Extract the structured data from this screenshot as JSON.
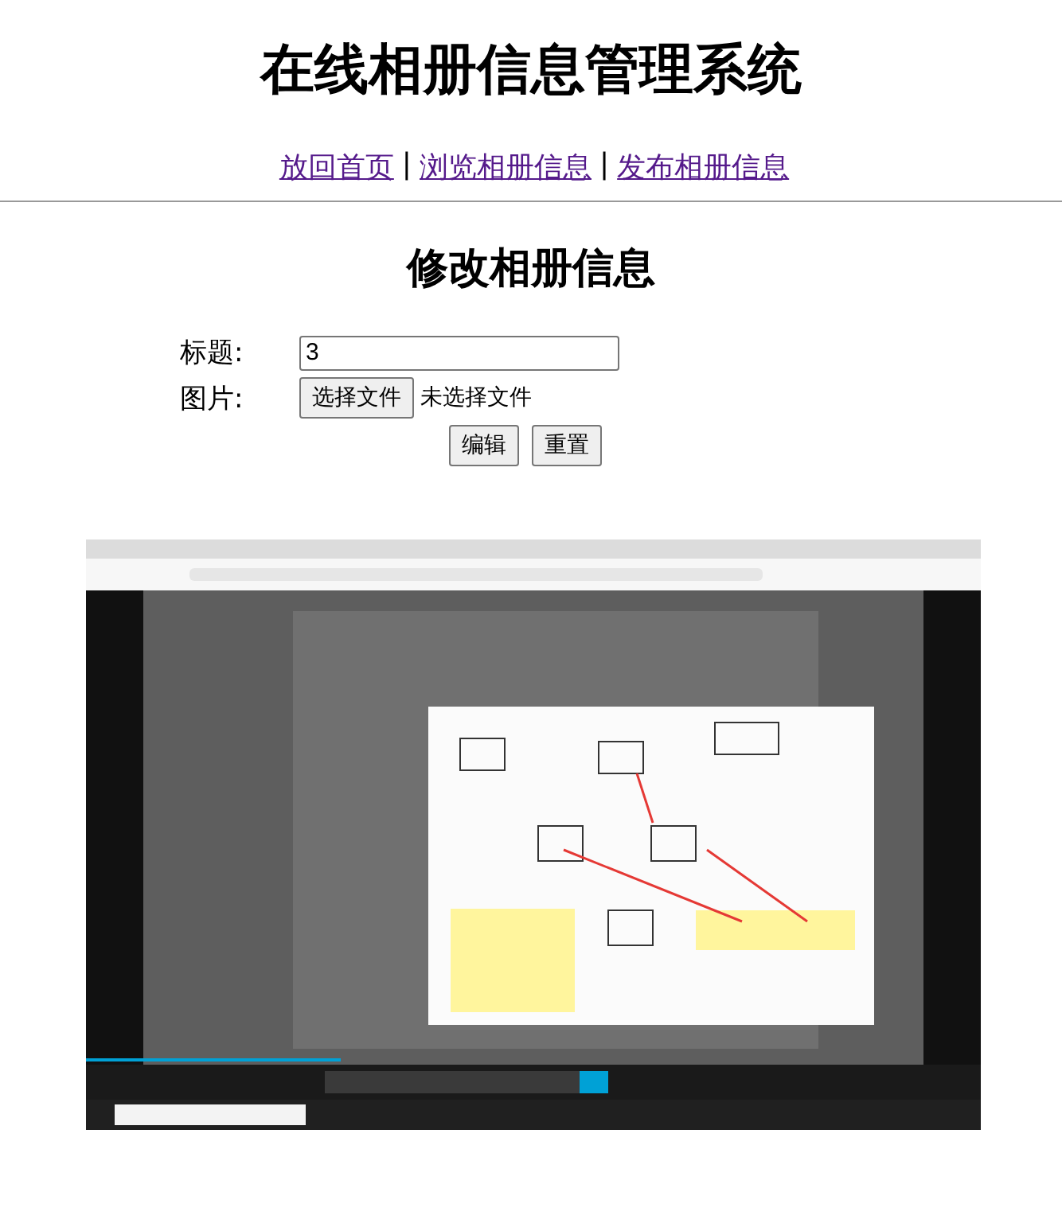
{
  "title": "在线相册信息管理系统",
  "nav": [
    {
      "label": "放回首页"
    },
    {
      "label": "浏览相册信息"
    },
    {
      "label": "发布相册信息"
    }
  ],
  "nav_separator": "|",
  "form": {
    "heading": "修改相册信息",
    "title_label": "标题:",
    "title_value": "3",
    "image_label": "图片:",
    "file_button": "选择文件",
    "file_status": "未选择文件",
    "buttons": [
      "编辑",
      "重置"
    ]
  }
}
